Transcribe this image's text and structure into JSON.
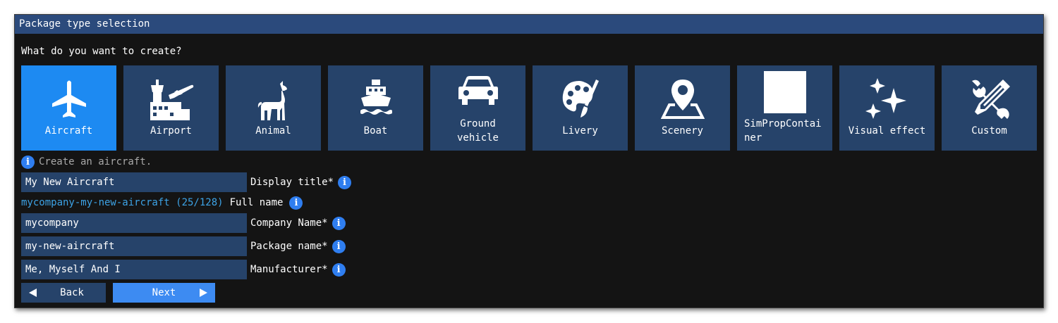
{
  "window": {
    "title": "Package type selection"
  },
  "question": "What do you want to create?",
  "tiles": [
    {
      "label": "Aircraft",
      "icon": "airplane-icon",
      "selected": true
    },
    {
      "label": "Airport",
      "icon": "airport-icon",
      "selected": false
    },
    {
      "label": "Animal",
      "icon": "llama-icon",
      "selected": false
    },
    {
      "label": "Boat",
      "icon": "ship-icon",
      "selected": false
    },
    {
      "label": "Ground\nvehicle",
      "label_line1": "Ground",
      "label_line2": "vehicle",
      "icon": "car-icon",
      "selected": false
    },
    {
      "label": "Livery",
      "icon": "palette-icon",
      "selected": false
    },
    {
      "label": "Scenery",
      "icon": "map-pin-icon",
      "selected": false
    },
    {
      "label": "SimPropContainer",
      "label_line1": "SimPropContai",
      "label_line2": "ner",
      "icon": "blank-square-icon",
      "selected": false
    },
    {
      "label": "Visual effect",
      "icon": "sparkles-icon",
      "selected": false
    },
    {
      "label": "Custom",
      "icon": "tools-icon",
      "selected": false
    }
  ],
  "description": "Create an aircraft.",
  "form": {
    "display_title": {
      "value": "My New Aircraft",
      "label": "Display title*"
    },
    "full_name": {
      "value": "mycompany-my-new-aircraft (25/128)",
      "label": "Full name"
    },
    "company_name": {
      "value": "mycompany",
      "label": "Company Name*"
    },
    "package_name": {
      "value": "my-new-aircraft",
      "label": "Package name*"
    },
    "manufacturer": {
      "value": "Me, Myself And I",
      "label": "Manufacturer*"
    }
  },
  "buttons": {
    "back": "Back",
    "next": "Next"
  },
  "info_glyph": "i",
  "colors": {
    "title_bar": "#2b4a7c",
    "tile": "#26436a",
    "tile_selected": "#1d8af2",
    "next_button": "#3d8bf2",
    "info": "#2f7ef0",
    "full_name_text": "#3da3e6"
  }
}
